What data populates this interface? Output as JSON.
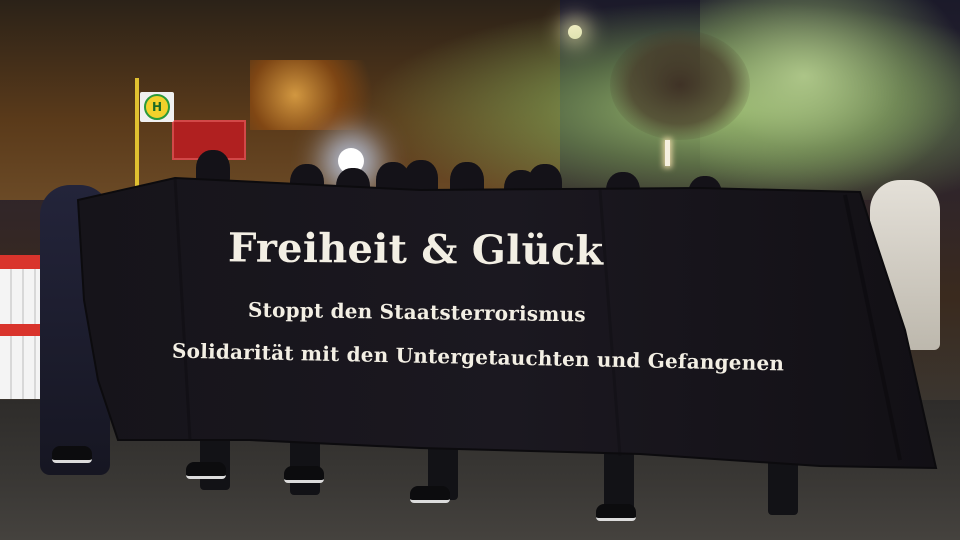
{
  "banner": {
    "title": "Freiheit & Glück",
    "line1": "Stoppt den Staatsterrorismus",
    "line2": "Solidarität mit den Untergetauchten und Gefangenen"
  },
  "bus_stop": {
    "symbol": "H"
  },
  "colors": {
    "banner": "#141217",
    "banner_text": "#f3efe4",
    "smoke_green": "#a9d27a",
    "barrier_red": "#d9342c"
  }
}
